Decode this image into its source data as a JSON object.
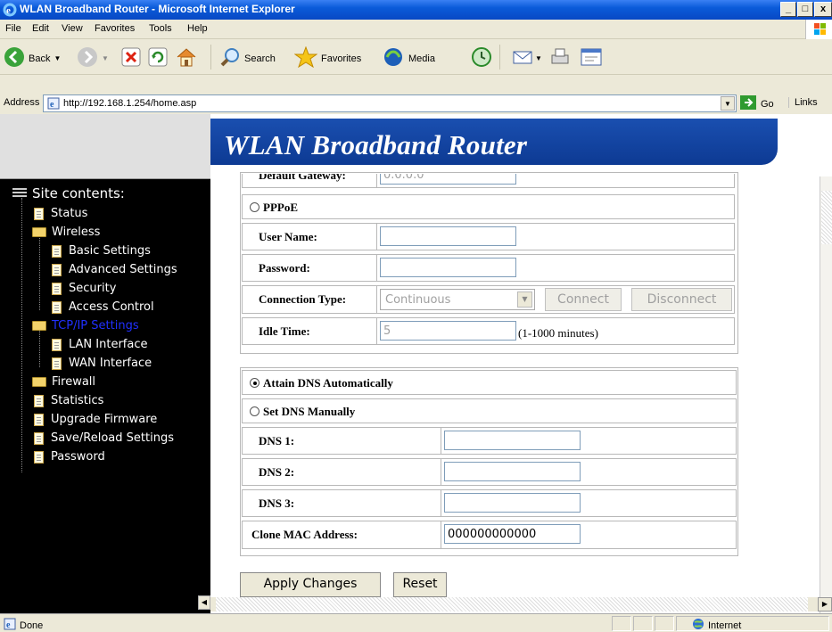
{
  "window": {
    "title": "WLAN Broadband Router - Microsoft Internet Explorer",
    "controls": [
      "_",
      "❒",
      "x"
    ]
  },
  "menu": [
    "File",
    "Edit",
    "View",
    "Favorites",
    "Tools",
    "Help"
  ],
  "toolbar": {
    "back_label": "Back",
    "search_label": "Search",
    "favorites_label": "Favorites",
    "media_label": "Media"
  },
  "address": {
    "label": "Address",
    "url": "http://192.168.1.254/home.asp",
    "go_label": "Go",
    "links_label": "Links"
  },
  "sidebar": {
    "root_label": "Site contents:",
    "items": [
      {
        "label": "Status"
      },
      {
        "label": "Wireless"
      },
      {
        "label": "Basic Settings"
      },
      {
        "label": "Advanced Settings"
      },
      {
        "label": "Security"
      },
      {
        "label": "Access Control"
      },
      {
        "label": "TCP/IP Settings"
      },
      {
        "label": "LAN Interface"
      },
      {
        "label": "WAN Interface"
      },
      {
        "label": "Firewall"
      },
      {
        "label": "Statistics"
      },
      {
        "label": "Upgrade Firmware"
      },
      {
        "label": "Save/Reload Settings"
      },
      {
        "label": "Password"
      }
    ]
  },
  "banner": {
    "title": "WLAN Broadband Router"
  },
  "form": {
    "default_gateway_label": "Default Gateway:",
    "default_gateway_value": "0.0.0.0",
    "pppoe_label": "PPPoE",
    "username_label": "User Name:",
    "username_value": "",
    "password_label": "Password:",
    "password_value": "",
    "conn_type_label": "Connection Type:",
    "conn_type_value": "Continuous",
    "connect_label": "Connect",
    "disconnect_label": "Disconnect",
    "idle_time_label": "Idle Time:",
    "idle_time_value": "5",
    "idle_time_hint": "(1-1000 minutes)",
    "dns_auto_label": "Attain DNS Automatically",
    "dns_manual_label": "Set DNS Manually",
    "dns1_label": "DNS 1:",
    "dns1_value": "",
    "dns2_label": "DNS 2:",
    "dns2_value": "",
    "dns3_label": "DNS 3:",
    "dns3_value": "",
    "clone_mac_label": "Clone MAC Address:",
    "clone_mac_value": "000000000000",
    "apply_label": "Apply Changes",
    "reset_label": "Reset"
  },
  "status": {
    "left_text": "Done",
    "zone_text": "Internet"
  }
}
